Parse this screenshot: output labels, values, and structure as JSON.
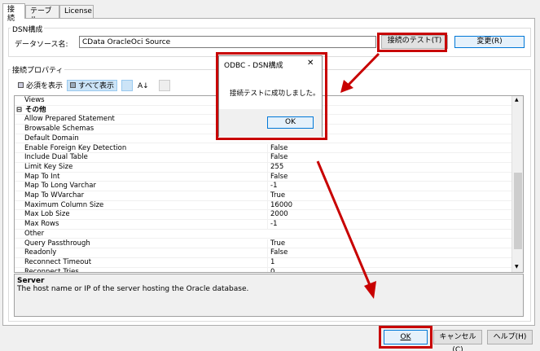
{
  "tabs": [
    {
      "label": "接続"
    },
    {
      "label": "テーブル"
    },
    {
      "label": "License"
    }
  ],
  "dsn_group": {
    "title": "DSN構成",
    "datasource_label": "データソース名:",
    "datasource_value": "CData OracleOci Source",
    "test_button": "接続のテスト(T)",
    "change_button": "変更(R)"
  },
  "properties_group": {
    "title": "接続プロパティ",
    "toolbar": {
      "required_label": "必須を表示",
      "all_label": "すべて表示",
      "sort_label": "A↓"
    },
    "rows": [
      {
        "name": "Views",
        "value": "",
        "category": false
      },
      {
        "name": "その他",
        "value": "",
        "category": true
      },
      {
        "name": "Allow Prepared Statement",
        "value": "",
        "category": false
      },
      {
        "name": "Browsable Schemas",
        "value": "",
        "category": false
      },
      {
        "name": "Default Domain",
        "value": "",
        "category": false
      },
      {
        "name": "Enable Foreign Key Detection",
        "value": "False",
        "category": false
      },
      {
        "name": "Include Dual Table",
        "value": "False",
        "category": false
      },
      {
        "name": "Limit Key Size",
        "value": "255",
        "category": false
      },
      {
        "name": "Map To Int",
        "value": "False",
        "category": false
      },
      {
        "name": "Map To Long Varchar",
        "value": "-1",
        "category": false
      },
      {
        "name": "Map To WVarchar",
        "value": "True",
        "category": false
      },
      {
        "name": "Maximum Column Size",
        "value": "16000",
        "category": false
      },
      {
        "name": "Max Lob Size",
        "value": "2000",
        "category": false
      },
      {
        "name": "Max Rows",
        "value": "-1",
        "category": false
      },
      {
        "name": "Other",
        "value": "",
        "category": false
      },
      {
        "name": "Query Passthrough",
        "value": "True",
        "category": false
      },
      {
        "name": "Readonly",
        "value": "False",
        "category": false
      },
      {
        "name": "Reconnect Timeout",
        "value": "1",
        "category": false
      },
      {
        "name": "Reconnect Tries",
        "value": "0",
        "category": false
      }
    ],
    "collapse_glyph": "⊟"
  },
  "description": {
    "title": "Server",
    "text": "The host name or IP of the server hosting the Oracle database."
  },
  "dialog": {
    "title": "ODBC - DSN構成",
    "message": "接続テストに成功しました。",
    "ok_button": "OK",
    "close_glyph": "✕"
  },
  "footer": {
    "ok_button": "OK",
    "cancel_button": "キャンセル(C)",
    "help_button": "ヘルプ(H)"
  },
  "colors": {
    "highlight_red": "#c80000",
    "accent_blue": "#0078d7"
  },
  "icons": {
    "scroll_up": "▲",
    "scroll_down": "▼"
  }
}
